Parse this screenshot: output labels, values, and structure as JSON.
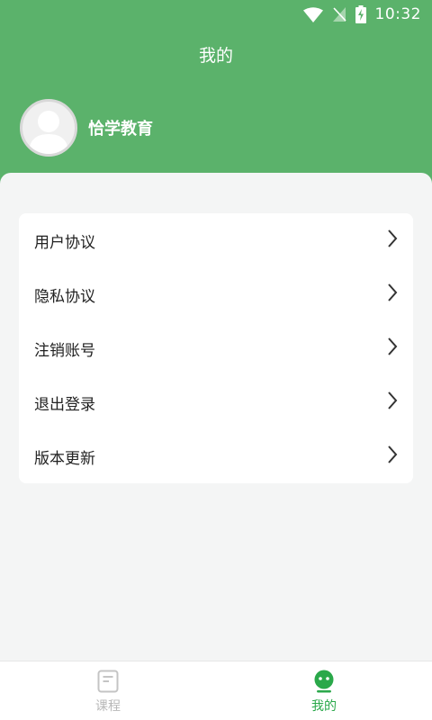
{
  "status_bar": {
    "time": "10:32",
    "icons": [
      "wifi-icon",
      "no-sim-icon",
      "battery-charging-icon"
    ]
  },
  "header": {
    "title": "我的",
    "background_color": "#5bb26b"
  },
  "profile": {
    "username": "恰学教育",
    "avatar_icon": "default-avatar-icon"
  },
  "menu": {
    "items": [
      {
        "label": "用户协议",
        "icon": "chevron-right-icon"
      },
      {
        "label": "隐私协议",
        "icon": "chevron-right-icon"
      },
      {
        "label": "注销账号",
        "icon": "chevron-right-icon"
      },
      {
        "label": "退出登录",
        "icon": "chevron-right-icon"
      },
      {
        "label": "版本更新",
        "icon": "chevron-right-icon"
      }
    ]
  },
  "tabbar": {
    "tabs": [
      {
        "label": "课程",
        "icon": "document-icon",
        "active": false
      },
      {
        "label": "我的",
        "icon": "robot-face-icon",
        "active": true
      }
    ],
    "active_color": "#2aa84a",
    "inactive_color": "#b8b8b8"
  }
}
